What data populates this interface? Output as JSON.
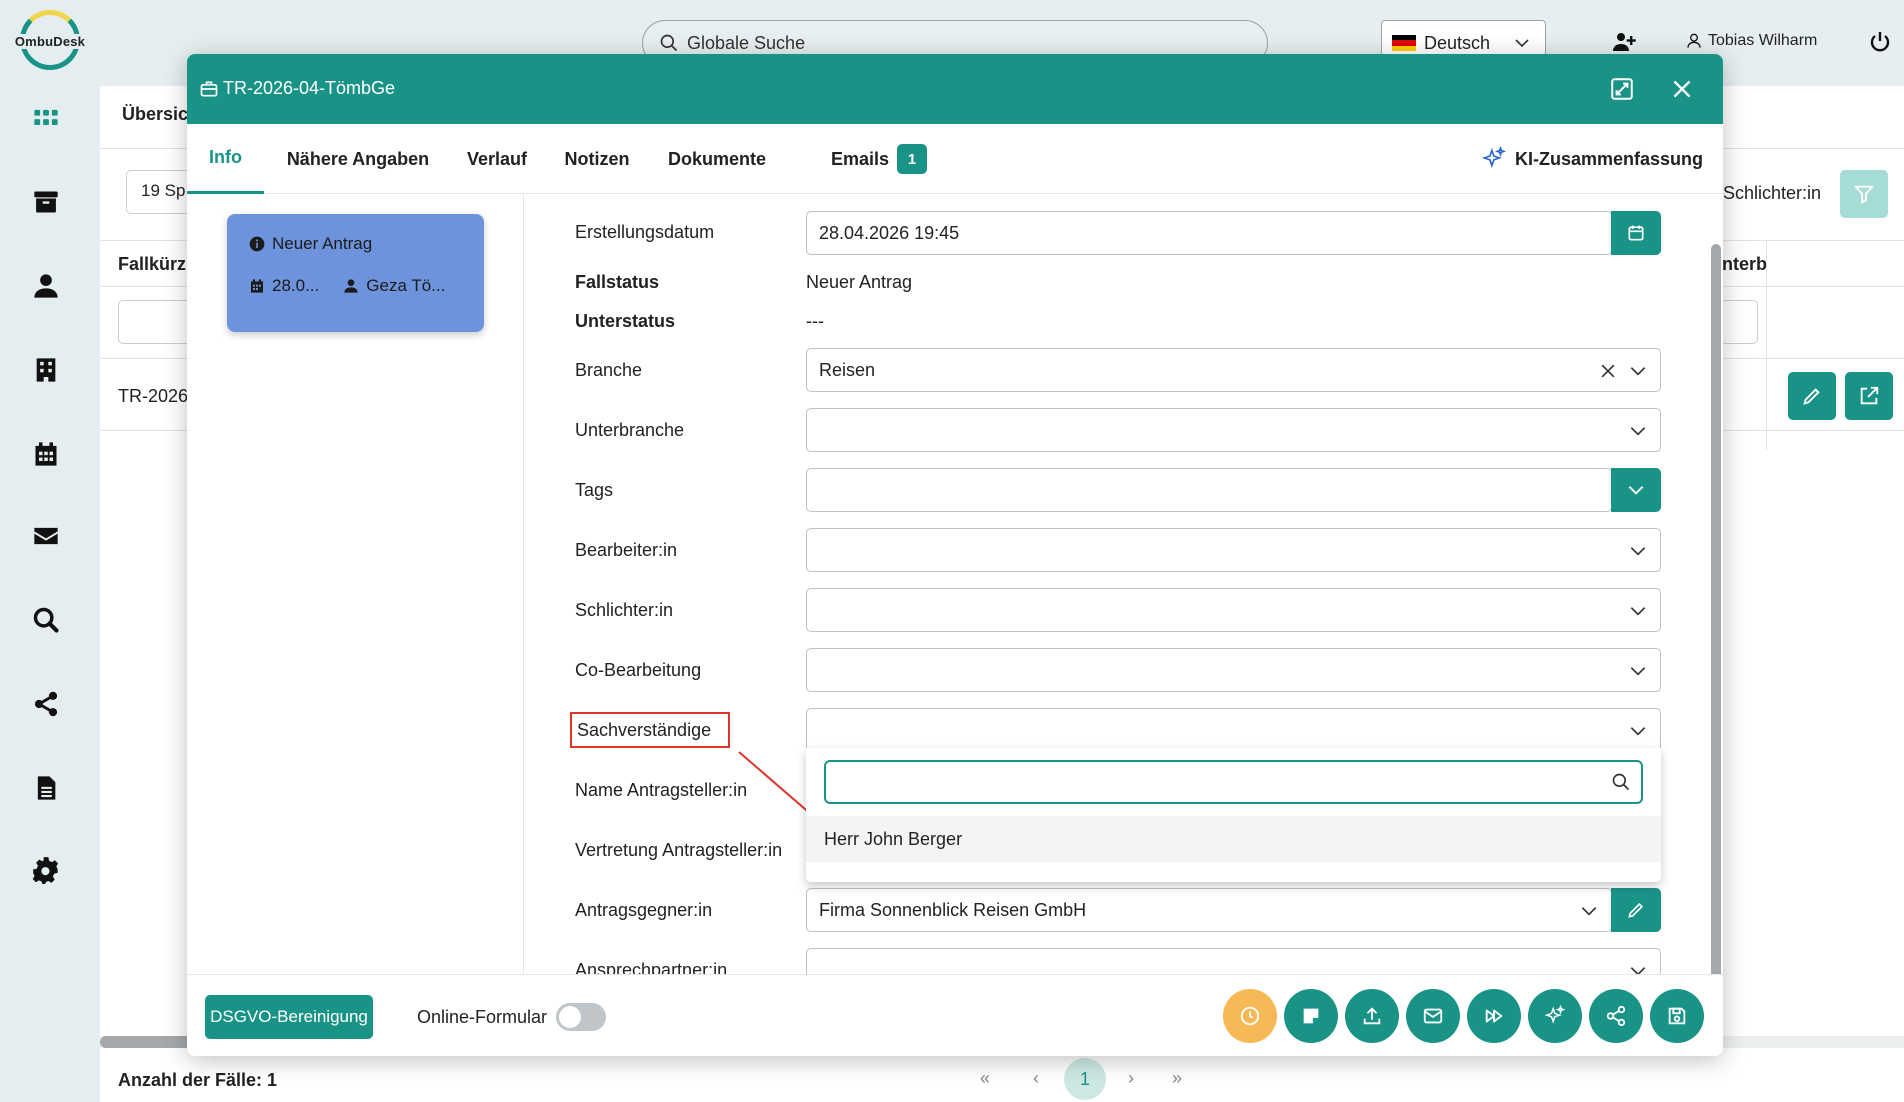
{
  "app": {
    "logo_text": "OmbuDesk",
    "search_placeholder": "Globale Suche",
    "language": "Deutsch",
    "user_name": "Tobias Wilharm"
  },
  "sidebar": {
    "icons": [
      "apps-grid-icon",
      "archive-icon",
      "user-icon",
      "building-icon",
      "calendar-icon",
      "mail-icon",
      "search-icon",
      "share-icon",
      "document-icon",
      "settings-icon"
    ]
  },
  "background": {
    "title_partial": "Übersic",
    "column_selector_partial": "19 Sp",
    "header_fallkurz_partial": "Fallkürz",
    "header_unterb_partial": "nterb",
    "filter_schlichter": "Schlichter:in",
    "row_case_partial": "TR-2026",
    "footer_count": "Anzahl der Fälle: 1",
    "pager": {
      "first": "«",
      "prev": "‹",
      "current": "1",
      "next": "›",
      "last": "»"
    }
  },
  "modal": {
    "title": "TR-2026-04-TömbGe",
    "tabs": [
      "Info",
      "Nähere Angaben",
      "Verlauf",
      "Notizen",
      "Dokumente",
      "Emails"
    ],
    "emails_badge": "1",
    "ki_label": "KI-Zusammenfassung",
    "card": {
      "status": "Neuer Antrag",
      "date": "28.0...",
      "person": "Geza Tö..."
    },
    "fields": {
      "erstellungsdatum_label": "Erstellungsdatum",
      "erstellungsdatum_value": "28.04.2026 19:45",
      "fallstatus_label": "Fallstatus",
      "fallstatus_value": "Neuer Antrag",
      "unterstatus_label": "Unterstatus",
      "unterstatus_value": "---",
      "branche_label": "Branche",
      "branche_value": "Reisen",
      "unterbranche_label": "Unterbranche",
      "tags_label": "Tags",
      "bearbeiter_label": "Bearbeiter:in",
      "schlichter_label": "Schlichter:in",
      "cobearbeitung_label": "Co-Bearbeitung",
      "sachverstaendige_label": "Sachverständige",
      "name_antragsteller_label": "Name Antragsteller:in",
      "vertretung_label": "Vertretung Antragsteller:in",
      "antragsgegner_label": "Antragsgegner:in",
      "antragsgegner_value": "Firma Sonnenblick Reisen GmbH",
      "ansprechpartner_label": "Ansprechpartner:in"
    },
    "dropdown": {
      "search_value": "",
      "options": [
        "Herr John Berger"
      ]
    },
    "footer": {
      "dsgvo_label": "DSGVO-Bereinigung",
      "online_label": "Online-Formular",
      "online_enabled": false
    }
  },
  "colors": {
    "primary": "#1a9387",
    "card": "#6d93dc",
    "highlight_box": "#e0342b",
    "timer_button": "#f7b955"
  }
}
